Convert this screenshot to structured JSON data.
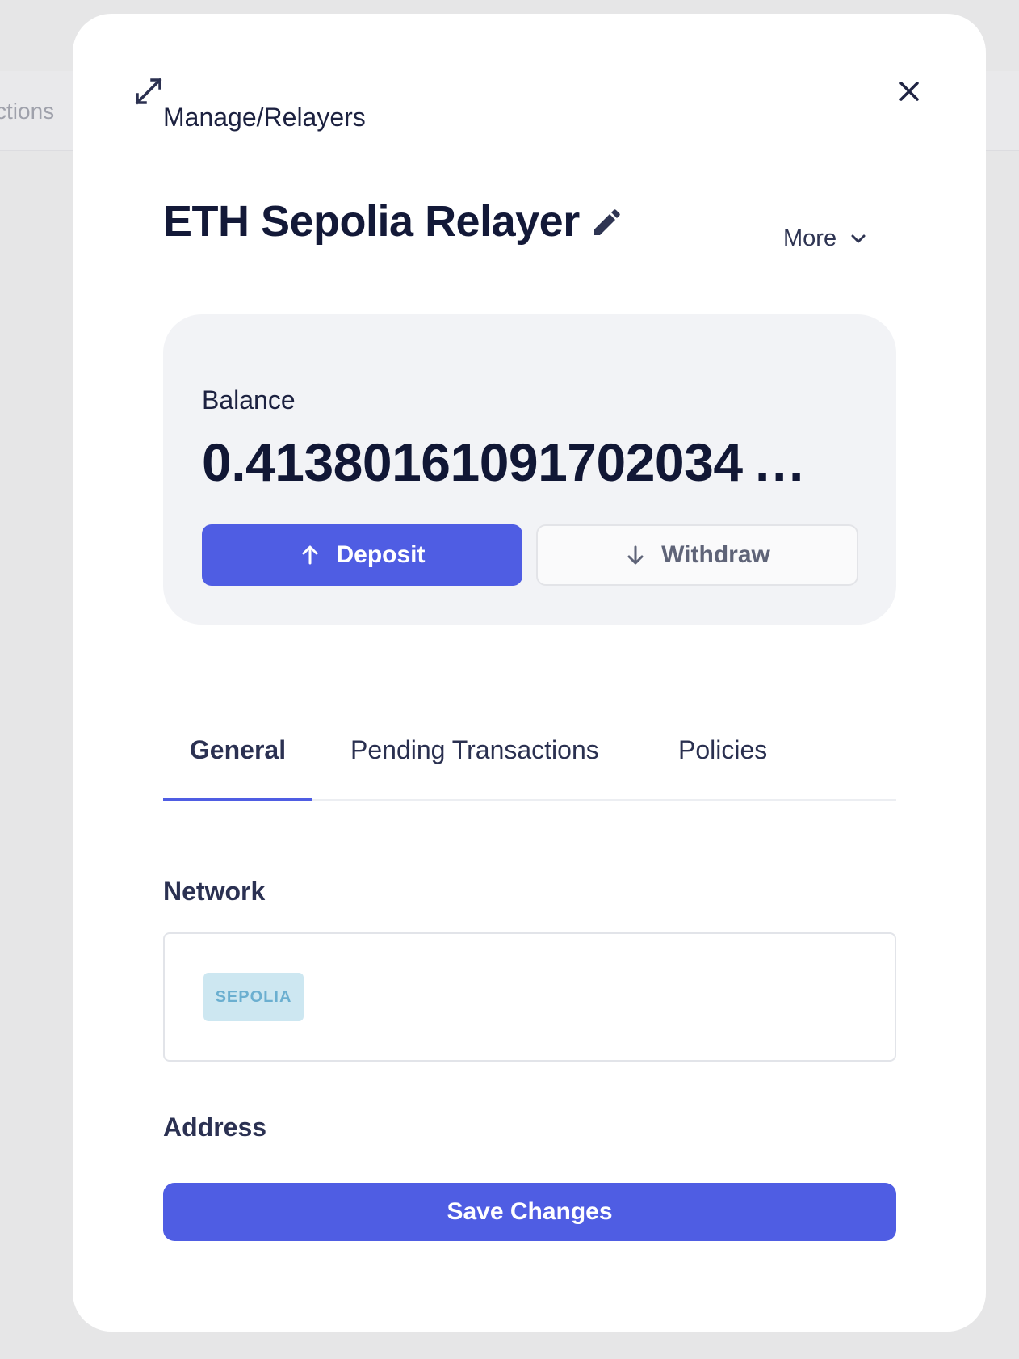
{
  "background": {
    "nav_fragment": "ctions"
  },
  "modal": {
    "breadcrumb": "Manage/Relayers",
    "title": "ETH Sepolia Relayer",
    "more_label": "More",
    "balance": {
      "label": "Balance",
      "value": "0.41380161091702034 …",
      "deposit_label": "Deposit",
      "withdraw_label": "Withdraw"
    },
    "tabs": [
      {
        "label": "General",
        "active": true
      },
      {
        "label": "Pending Transactions",
        "active": false
      },
      {
        "label": "Policies",
        "active": false
      }
    ],
    "network": {
      "label": "Network",
      "badge": "SEPOLIA"
    },
    "address": {
      "label": "Address"
    },
    "save_label": "Save Changes"
  },
  "colors": {
    "accent": "#4f5de3",
    "badge_bg": "#cde7f1",
    "badge_text": "#6bafd0"
  },
  "icons": [
    "expand-icon",
    "close-icon",
    "edit-icon",
    "chevron-down-icon",
    "arrow-up-icon",
    "arrow-down-icon"
  ]
}
